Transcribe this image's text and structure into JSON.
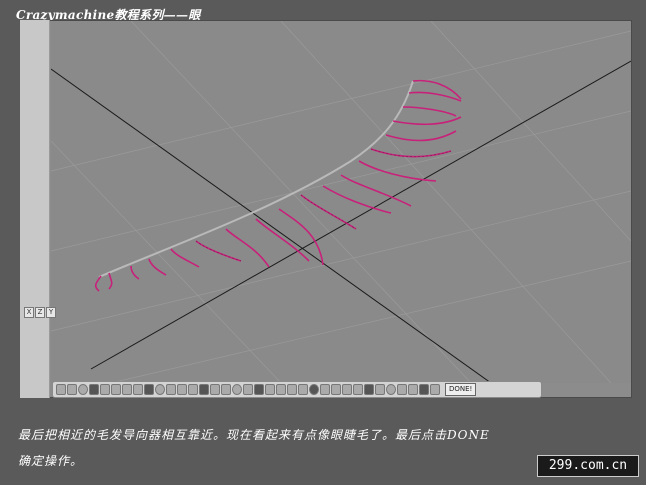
{
  "header": {
    "title": "Crazymachine教程系列——眼"
  },
  "viewport": {
    "axis_labels": [
      "X",
      "Z",
      "Y"
    ],
    "line_color": "#1a1a1a",
    "grid_color": "#9a9a9a",
    "hair_color": "#c8217a",
    "done_label": "DONE!"
  },
  "toolbar": {
    "icons": [
      "curve-tool-icon",
      "curve-tool-icon",
      "curve-tool-icon",
      "curve-tool-icon",
      "pen-icon",
      "lasso-icon",
      "circle-icon",
      "bend-icon",
      "comb-icon",
      "rotate-icon",
      "arrow-icon",
      "brush-icon",
      "grid-icon",
      "wave-icon",
      "comb-icon",
      "wave-icon",
      "pin-icon",
      "twist-icon",
      "smooth-icon",
      "cut-icon",
      "knot-icon",
      "loop-icon",
      "globe-icon",
      "sphere-icon",
      "gear-icon",
      "gear-icon",
      "settings-icon",
      "color-icon",
      "lock-icon",
      "stack-icon",
      "stack-icon",
      "arrow-up-icon",
      "grab-icon",
      "grab-icon",
      "undo-icon"
    ]
  },
  "caption": {
    "line1": "最后把相近的毛发导向器相互靠近。现在看起来有点像眼睫毛了。最后点击DONE",
    "line2": "确定操作。"
  },
  "watermark": {
    "text": "299.com.cn"
  }
}
